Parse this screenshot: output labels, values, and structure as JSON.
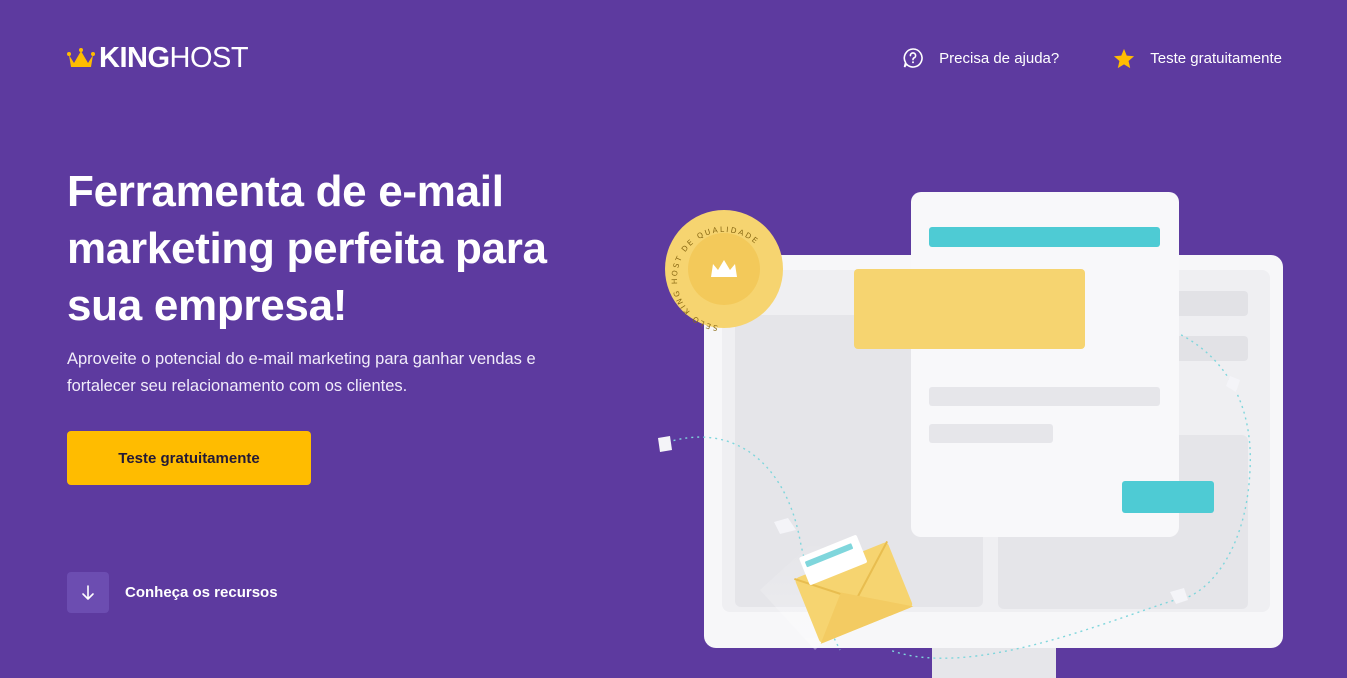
{
  "brand": {
    "name_bold": "KING",
    "name_light": "HOST",
    "accent_color": "#ffbc00"
  },
  "nav": {
    "help_label": "Precisa de ajuda?",
    "help_icon": "question-bubble-icon",
    "trial_label": "Teste gratuitamente",
    "trial_icon": "star-icon"
  },
  "hero": {
    "title": "Ferramenta de e-mail marketing perfeita para sua empresa!",
    "subtitle": "Aproveite o potencial do e-mail marketing para ganhar vendas e fortalecer seu relacionamento com os clientes.",
    "cta_label": "Teste gratuitamente"
  },
  "resources": {
    "label": "Conheça os recursos",
    "icon": "arrow-down-icon"
  },
  "illustration": {
    "seal_text": "SELO KING HOST DE QUALIDADE",
    "colors": {
      "background": "#5d3a9f",
      "seal": "#f6d470",
      "teal": "#4ecbd4",
      "yellow_block": "#f6d470",
      "card": "#f8f8fa"
    }
  }
}
